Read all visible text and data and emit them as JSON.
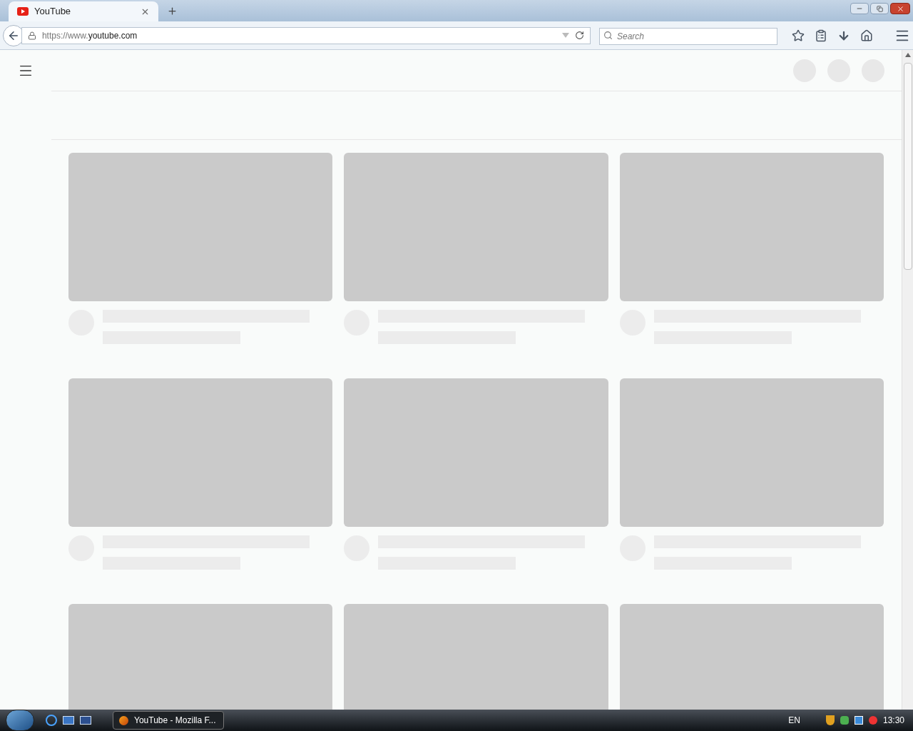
{
  "browser": {
    "tabs": [
      {
        "label": "YouTube",
        "selected": true
      }
    ],
    "url": {
      "prefix": "https://www.",
      "domain": "youtube.com"
    },
    "search": {
      "placeholder": "Search"
    }
  },
  "page": {
    "header_avatars": [
      {
        "kind": "skeleton"
      },
      {
        "kind": "skeleton"
      },
      {
        "kind": "skeleton"
      }
    ],
    "cards": [
      {
        "kind": "skeleton"
      },
      {
        "kind": "skeleton"
      },
      {
        "kind": "skeleton"
      },
      {
        "kind": "skeleton"
      },
      {
        "kind": "skeleton"
      },
      {
        "kind": "skeleton"
      },
      {
        "kind": "thumbnail_only"
      },
      {
        "kind": "thumbnail_only"
      },
      {
        "kind": "thumbnail_only"
      }
    ]
  },
  "taskbar": {
    "tasks": [
      {
        "label": "YouTube - Mozilla F...",
        "selected": true
      }
    ],
    "language": "EN",
    "clock": "13:30"
  }
}
